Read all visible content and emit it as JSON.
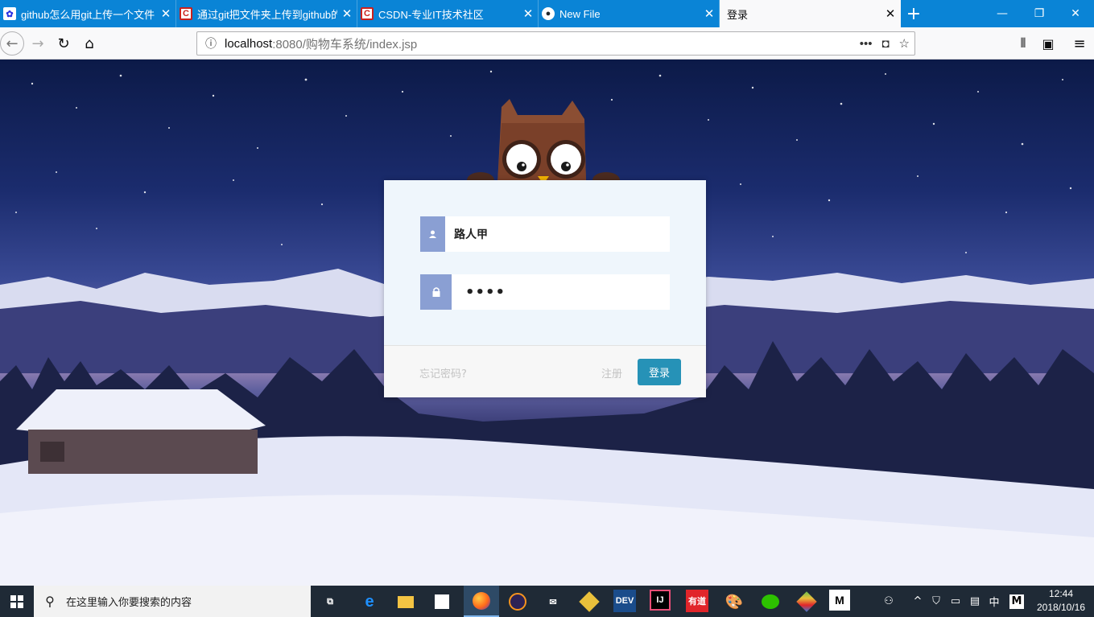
{
  "browser": {
    "tabs": [
      {
        "title": "github怎么用git上传一个文件",
        "favicon": "baidu-paw-icon",
        "active": false
      },
      {
        "title": "通过git把文件夹上传到github的",
        "favicon": "csdn-icon",
        "active": false
      },
      {
        "title": "CSDN-专业IT技术社区",
        "favicon": "csdn-icon",
        "active": false
      },
      {
        "title": "New File",
        "favicon": "github-icon",
        "active": false
      },
      {
        "title": "登录",
        "favicon": "",
        "active": true
      }
    ],
    "url_host": "localhost",
    "url_rest": ":8080/购物车系统/index.jsp"
  },
  "login": {
    "username_value": "路人甲",
    "password_mask": "••••",
    "forgot_label": "忘记密码?",
    "register_label": "注册",
    "login_label": "登录",
    "accent_color": "#2692b7",
    "icon_bg_color": "#8a9fd3"
  },
  "taskbar": {
    "search_placeholder": "在这里输入你要搜索的内容",
    "time": "12:44",
    "date": "2018/10/16",
    "ime": "中",
    "apps": [
      "task-view-icon",
      "edge-icon",
      "file-explorer-icon",
      "store-icon",
      "firefox-icon",
      "eclipse-icon",
      "mail-icon",
      "app-icon",
      "devcpp-icon",
      "intellij-icon",
      "youdao-icon",
      "paint-icon",
      "wechat-icon",
      "git-icon",
      "m-app-icon"
    ],
    "labels": {
      "devcpp": "DEV",
      "intellij": "IJ",
      "youdao": "有道",
      "m": "M"
    }
  }
}
